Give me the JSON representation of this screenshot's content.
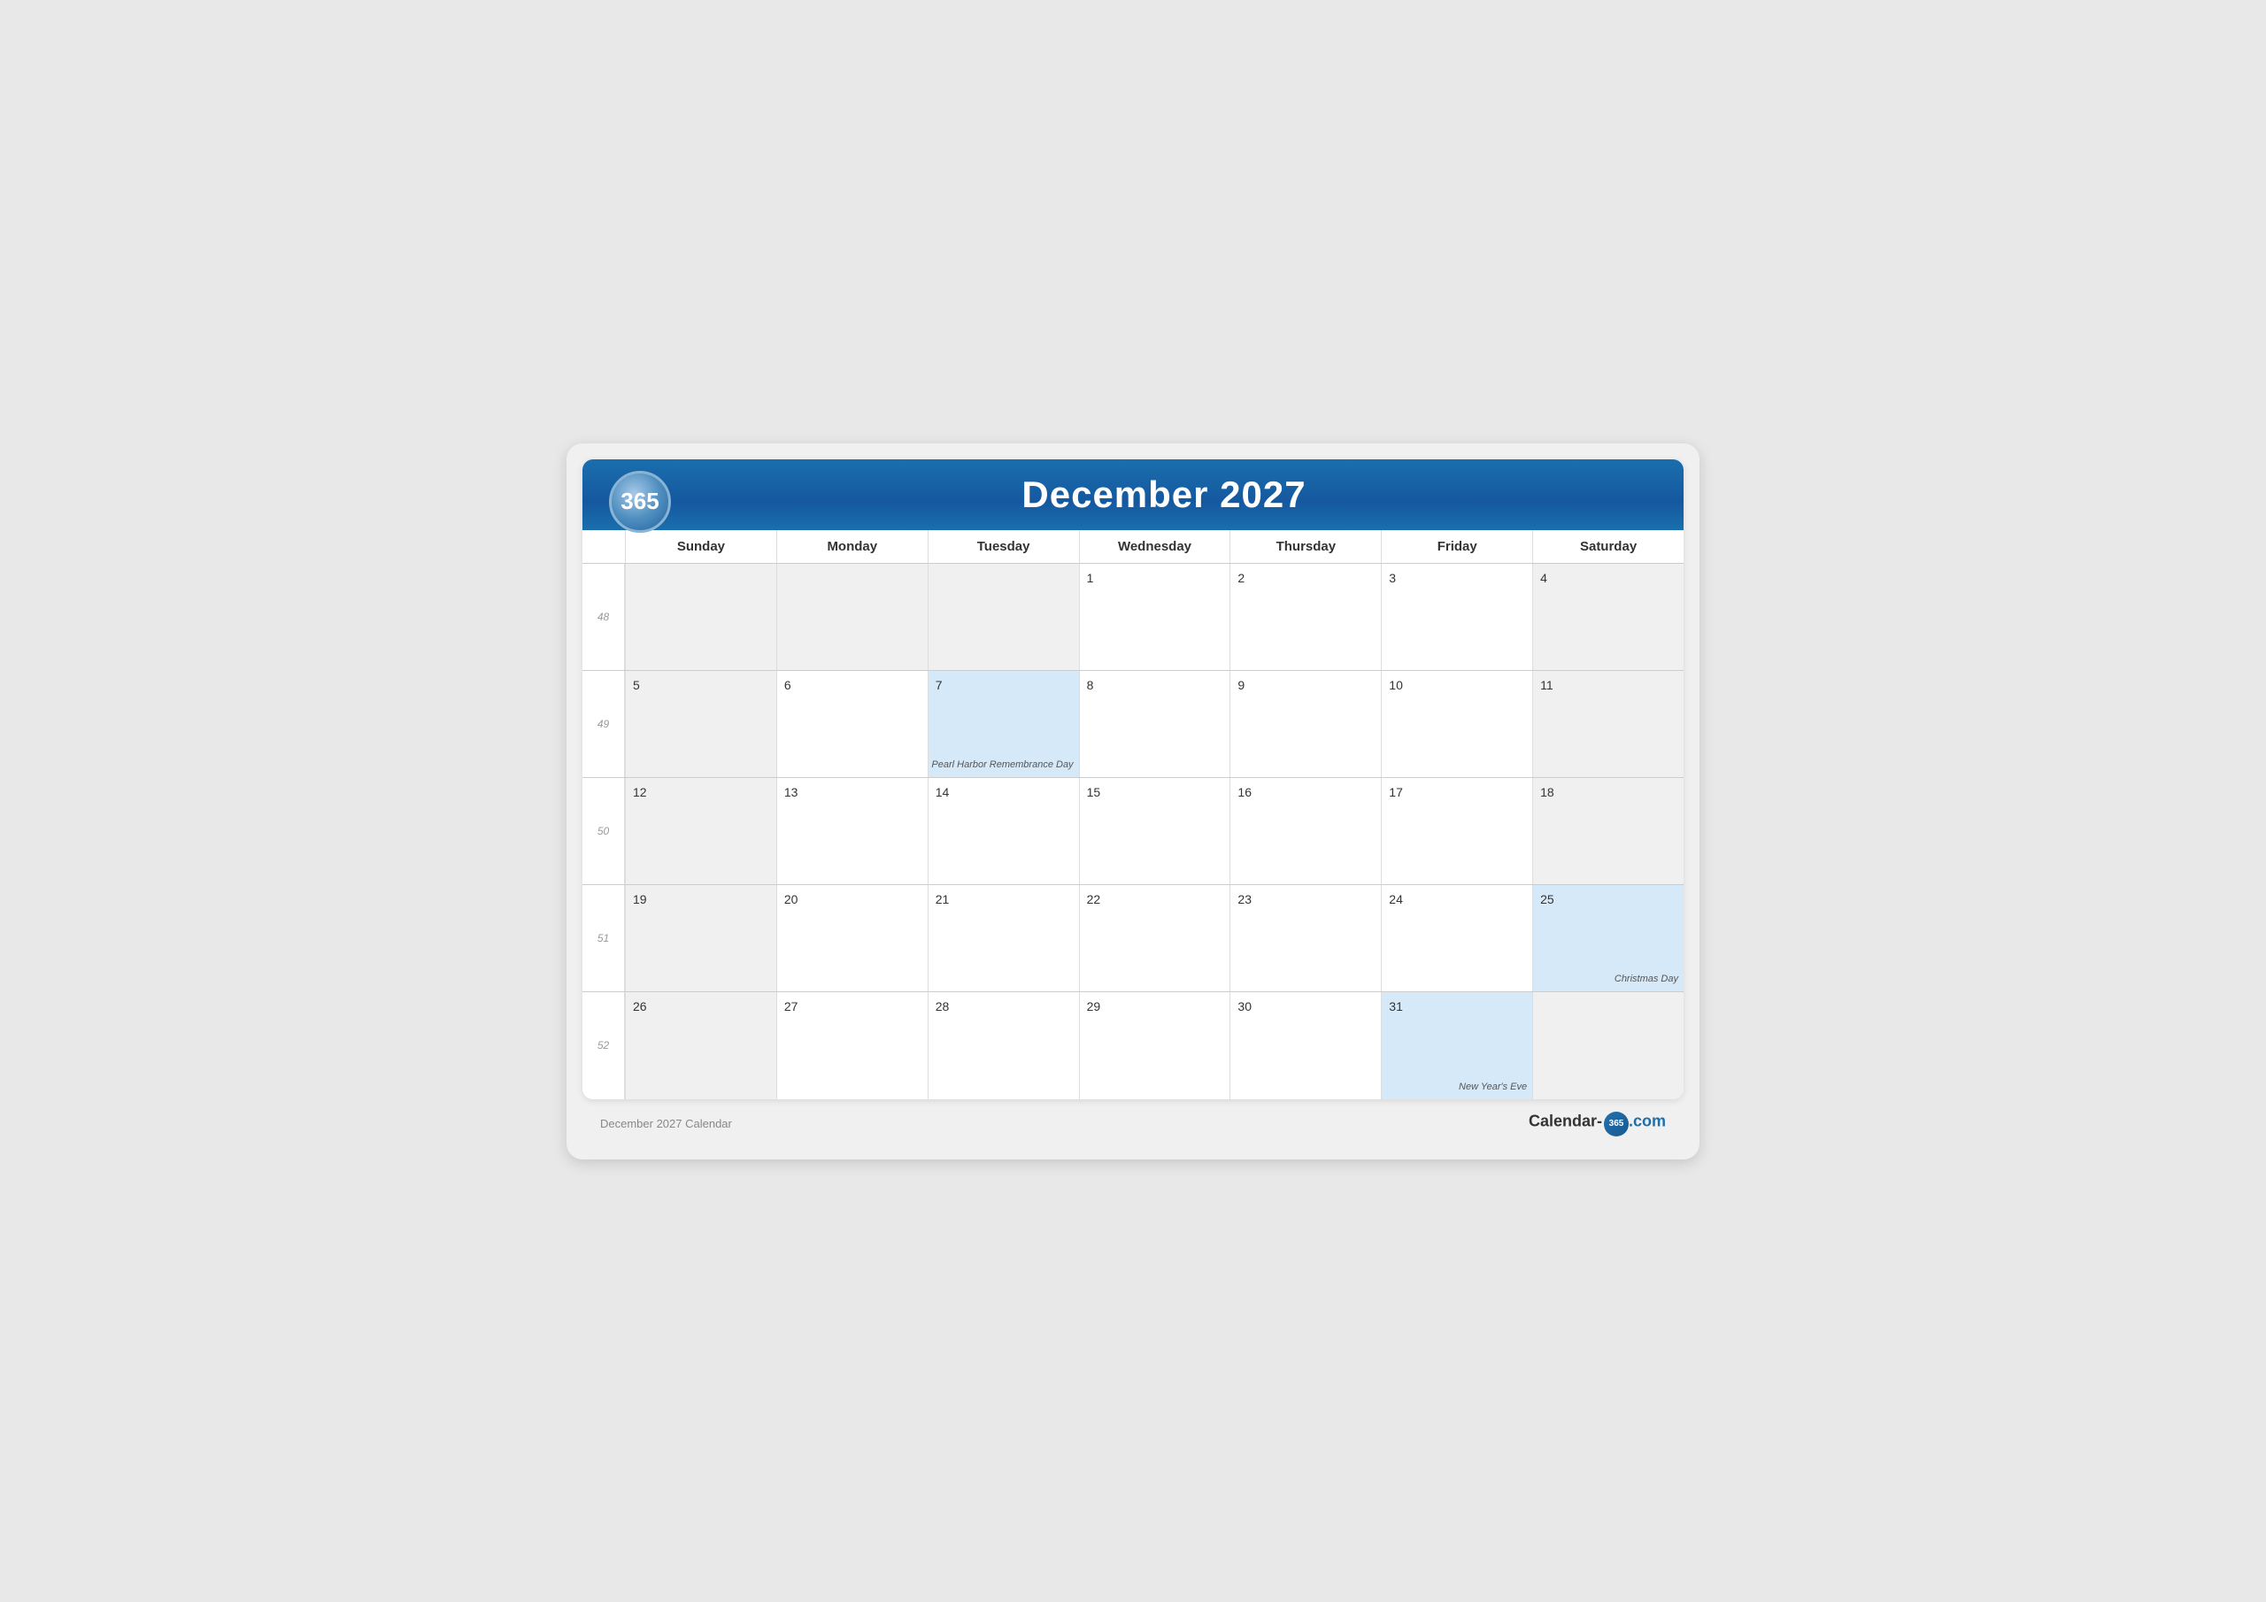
{
  "header": {
    "logo": "365",
    "title": "December 2027"
  },
  "days_of_week": [
    "Sunday",
    "Monday",
    "Tuesday",
    "Wednesday",
    "Thursday",
    "Friday",
    "Saturday"
  ],
  "footer": {
    "left": "December 2027 Calendar",
    "brand": "Calendar-365.com"
  },
  "weeks": [
    {
      "week_num": "48",
      "days": [
        {
          "date": "",
          "empty": true,
          "sunday": true
        },
        {
          "date": "",
          "empty": true
        },
        {
          "date": "",
          "empty": true
        },
        {
          "date": "1",
          "empty": false
        },
        {
          "date": "2",
          "empty": false
        },
        {
          "date": "3",
          "empty": false
        },
        {
          "date": "4",
          "empty": false,
          "sunday": true
        }
      ]
    },
    {
      "week_num": "49",
      "days": [
        {
          "date": "5",
          "empty": false,
          "sunday": true
        },
        {
          "date": "6",
          "empty": false
        },
        {
          "date": "7",
          "empty": false,
          "highlighted": true,
          "event": "Pearl Harbor Remembrance Day"
        },
        {
          "date": "8",
          "empty": false
        },
        {
          "date": "9",
          "empty": false
        },
        {
          "date": "10",
          "empty": false
        },
        {
          "date": "11",
          "empty": false,
          "sunday": true
        }
      ]
    },
    {
      "week_num": "50",
      "days": [
        {
          "date": "12",
          "empty": false,
          "sunday": true
        },
        {
          "date": "13",
          "empty": false
        },
        {
          "date": "14",
          "empty": false
        },
        {
          "date": "15",
          "empty": false
        },
        {
          "date": "16",
          "empty": false
        },
        {
          "date": "17",
          "empty": false
        },
        {
          "date": "18",
          "empty": false,
          "sunday": true
        }
      ]
    },
    {
      "week_num": "51",
      "days": [
        {
          "date": "19",
          "empty": false,
          "sunday": true
        },
        {
          "date": "20",
          "empty": false
        },
        {
          "date": "21",
          "empty": false
        },
        {
          "date": "22",
          "empty": false
        },
        {
          "date": "23",
          "empty": false
        },
        {
          "date": "24",
          "empty": false
        },
        {
          "date": "25",
          "empty": false,
          "highlighted": true,
          "event": "Christmas Day",
          "sunday": true
        }
      ]
    },
    {
      "week_num": "52",
      "days": [
        {
          "date": "26",
          "empty": false,
          "sunday": true
        },
        {
          "date": "27",
          "empty": false
        },
        {
          "date": "28",
          "empty": false
        },
        {
          "date": "29",
          "empty": false
        },
        {
          "date": "30",
          "empty": false
        },
        {
          "date": "31",
          "empty": false,
          "highlighted": true,
          "event": "New Year's Eve"
        },
        {
          "date": "",
          "empty": true,
          "sunday": true
        }
      ]
    }
  ]
}
